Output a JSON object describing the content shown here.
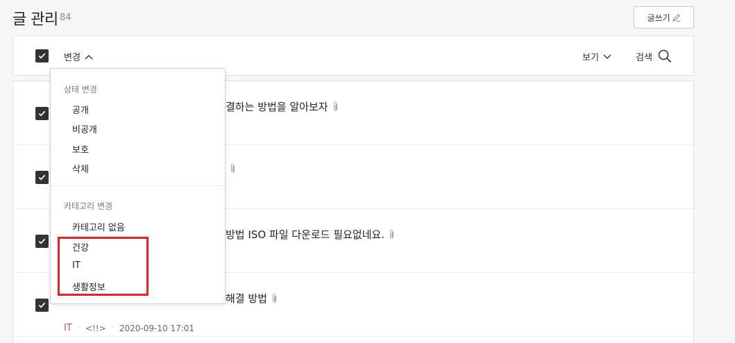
{
  "header": {
    "title": "글 관리",
    "count": "84",
    "write_button": "글쓰기"
  },
  "toolbar": {
    "change_label": "변경",
    "view_label": "보기",
    "search_label": "검색"
  },
  "dropdown": {
    "status_section": "상태 변경",
    "status_items": [
      "공개",
      "비공개",
      "보호",
      "삭제"
    ],
    "category_section": "카테고리 변경",
    "category_items": [
      "카테고리 없음",
      "건강",
      "IT",
      "생활정보"
    ]
  },
  "posts": [
    {
      "title": "결하는 방법을 알아보자",
      "category": "",
      "author": "",
      "date": ""
    },
    {
      "title": "",
      "category": "",
      "author": "",
      "date": ""
    },
    {
      "title": "방법 ISO 파일 다운로드 필요없네요.",
      "category": "",
      "author": "",
      "date": ""
    },
    {
      "title": "해결 방법",
      "category": "IT",
      "author": "<!!>",
      "date": "2020-09-10 17:01"
    }
  ],
  "colors": {
    "accent_red": "#e0442f",
    "highlight_red": "#e8202a",
    "checkbox": "#333333"
  }
}
